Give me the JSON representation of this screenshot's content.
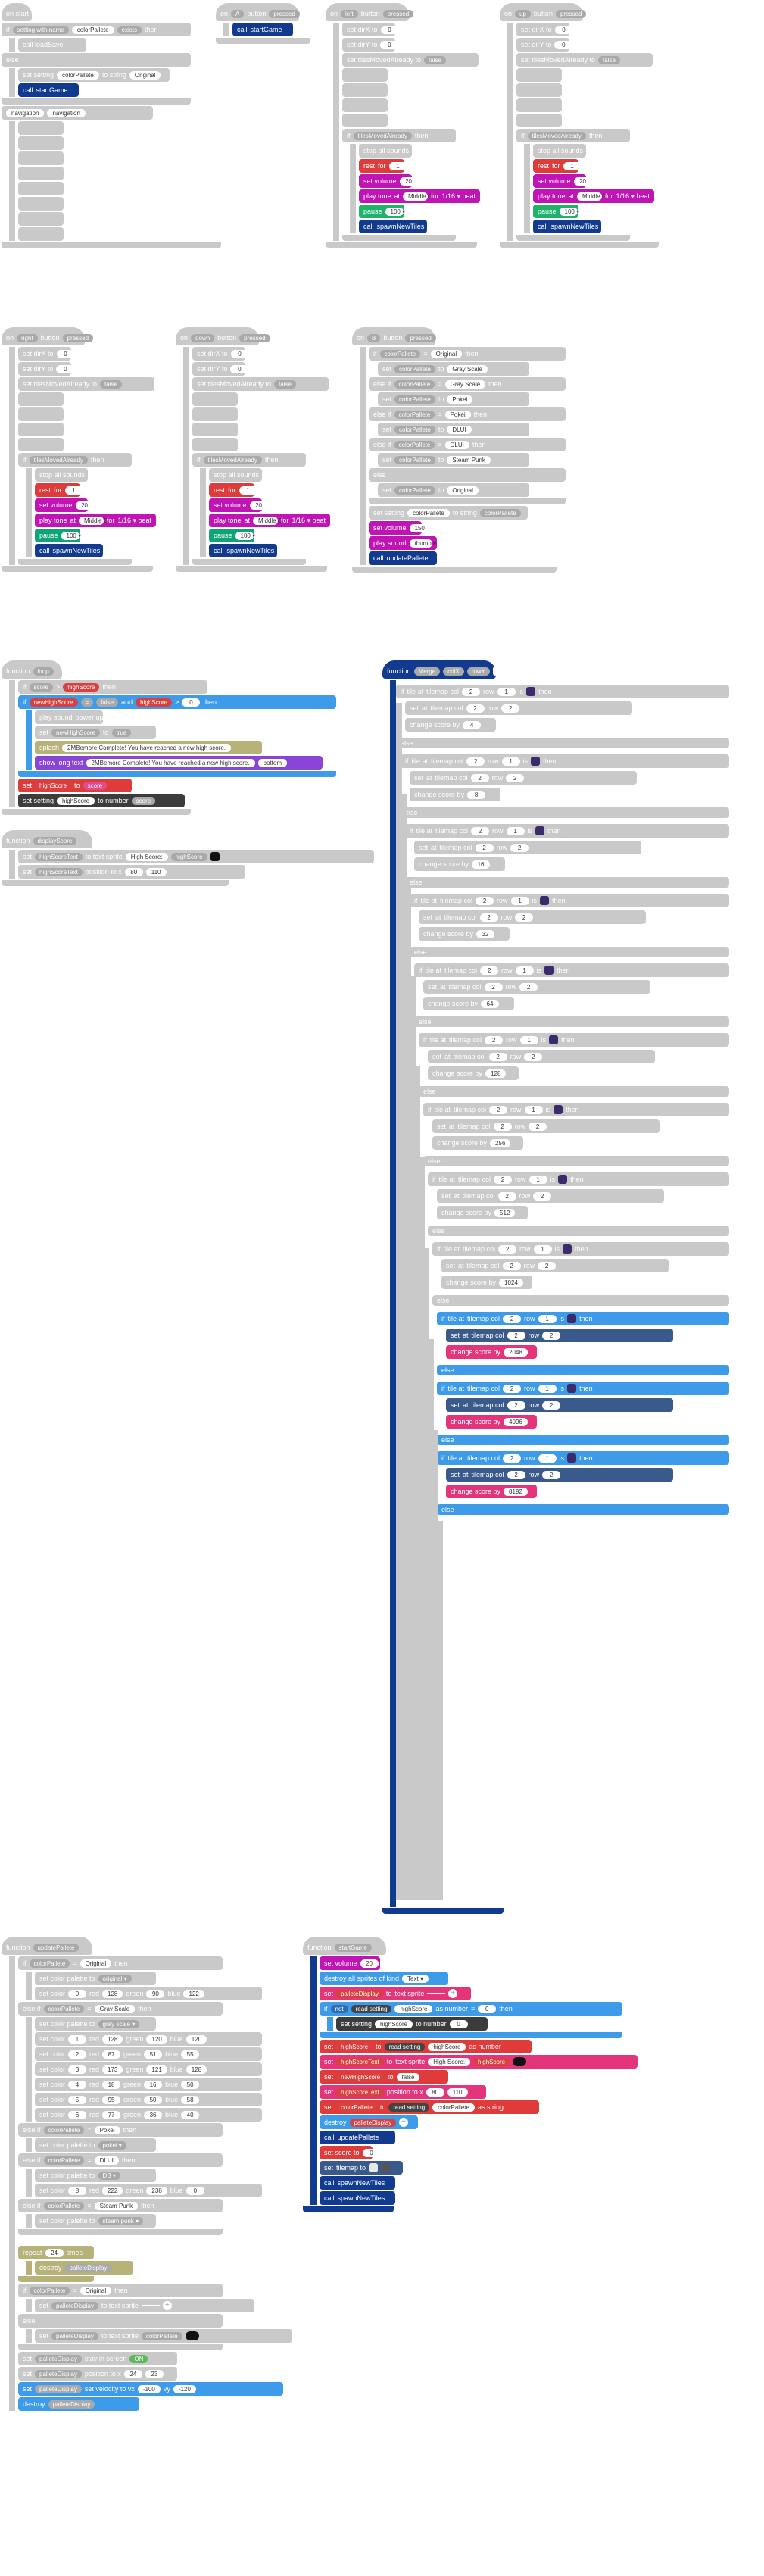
{
  "blocks": {
    "top": {
      "if_label": "if",
      "then_label": "then",
      "else_label": "else",
      "color_palette_var": "colorPallete",
      "original": "Original",
      "call": "call",
      "start_game": "startGame",
      "set": "set",
      "to": "to",
      "on": "on",
      "button": "button",
      "pressed": "pressed",
      "zero": "0",
      "false": "false",
      "true": "true",
      "repeat": "repeat",
      "one": "1",
      "set_volume": "set volume",
      "play_tone": "play tone",
      "at": "at",
      "middle_c": "Middle C",
      "for": "for",
      "beat": "1/16 ▾ beat",
      "pause": "pause",
      "hundred": "100 ▾",
      "ms": "ms",
      "spawn": "spawnNewTiles",
      "navigation": "navigation",
      "left": "left",
      "right": "right",
      "up": "up",
      "down": "down",
      "a": "A"
    },
    "palette_if": {
      "gray_scale": "Gray Scale",
      "pokei": "Pokei",
      "dlui": "DLUI",
      "steam_punk": "Steam Punk",
      "original": "Original",
      "in_string": "to string",
      "set_volume_val": "150",
      "play_sound": "play sound",
      "sound": "thump ▾",
      "update_palette": "updatePallete"
    },
    "loop_section": {
      "loop_label": "loop",
      "new_high_score": "newHighScore",
      "high_score": "highScore",
      "and": "and",
      "gt": ">",
      "zero": "0",
      "play_sound": "play sound",
      "power_up": "power up",
      "set_new": "set",
      "true": "true",
      "splash": "splash",
      "splash_text": "2MBemore Complete! You have reached a new high score.",
      "show_long_text": "show long text",
      "long_text": "2MBemore Complete! You have reached a new high score.",
      "bottom": "bottom",
      "set_setting": "set setting",
      "to_number": "to number",
      "score": "score",
      "high_score_label": "highScore",
      "function": "function",
      "display_label": "highScoreText",
      "text_sprite": "to text sprite",
      "high_score_str": "High Score:",
      "position": "position to x",
      "x_val": "80",
      "y_val": "110"
    },
    "merge_function": {
      "function": "function",
      "merge": "Merge",
      "x": "colX",
      "y": "rowY",
      "if": "if",
      "tile_at": "tile at",
      "tilemap_col": "tilemap col",
      "row": "row",
      "is": "is",
      "then": "then",
      "else": "else",
      "set": "set",
      "at": "at",
      "change_score_by": "change score by",
      "scores": [
        "4",
        "8",
        "16",
        "32",
        "64",
        "128",
        "256",
        "512",
        "1024",
        "2048",
        "4096",
        "8192"
      ],
      "two": "2",
      "one": "1",
      "plus": "+",
      "minus": "-"
    },
    "update_pallete": {
      "function": "function",
      "name": "updatePallete",
      "if": "if",
      "color_palette": "colorPallete",
      "eq": "=",
      "original": "Original",
      "then": "then",
      "set_palette": "set color palette to",
      "original_lc": "original ▾",
      "set_color": "set color",
      "red": "red",
      "green": "green",
      "blue": "blue",
      "colors": [
        [
          "0",
          "128",
          "90",
          "122"
        ],
        [
          "1",
          "128",
          "120",
          "120"
        ],
        [
          "2",
          "87",
          "51",
          "55"
        ],
        [
          "3",
          "173",
          "121",
          "128"
        ],
        [
          "4",
          "18",
          "16",
          "50"
        ],
        [
          "5",
          "95",
          "50",
          "58"
        ],
        [
          "6",
          "77",
          "36",
          "40"
        ]
      ],
      "gray_scale": "Gray Scale",
      "pokei": "Pokei",
      "dlui": "DLUI",
      "steam_punk": "Steam Punk",
      "repeat": "repeat",
      "times": "times",
      "destroy": "destroy",
      "pallete_display": "palleteDisplay",
      "text_sprite": "to text sprite",
      "set_velocity": "set velocity to vx",
      "vx": "-100",
      "vy": "-120",
      "position": "position to x",
      "pos_x": "24",
      "pos_y": "23",
      "grid_val": "24",
      "destroy_label": "destroy"
    },
    "start_game": {
      "function": "function",
      "name": "startGame",
      "set_volume": "set volume",
      "vol": "20",
      "destroy_all": "destroy all sprites of kind",
      "text_kind": "Text ▾",
      "set": "set",
      "pallete_display": "palleteDisplay",
      "to": "to",
      "text_sprite": "text sprite",
      "if": "if",
      "not": "not",
      "read_setting": "read setting",
      "high_score": "highScore",
      "as_number": "as number",
      "eq": "=",
      "zero": "0",
      "then": "then",
      "set_setting": "set setting",
      "to_number": "to number",
      "high_score_var": "highScore",
      "high_score_text": "highScoreText",
      "high_score_label": "High Score:",
      "new_high_score": "newHighScore",
      "false": "false",
      "position_x": "position to x",
      "px": "80",
      "py": "110",
      "color_pallete": "colorPallete",
      "as_string": "as string",
      "destroy": "destroy",
      "call": "call",
      "update": "updatePallete",
      "set_score": "set score to",
      "tilemap": "tilemap",
      "spawn": "spawnNewTiles"
    }
  }
}
